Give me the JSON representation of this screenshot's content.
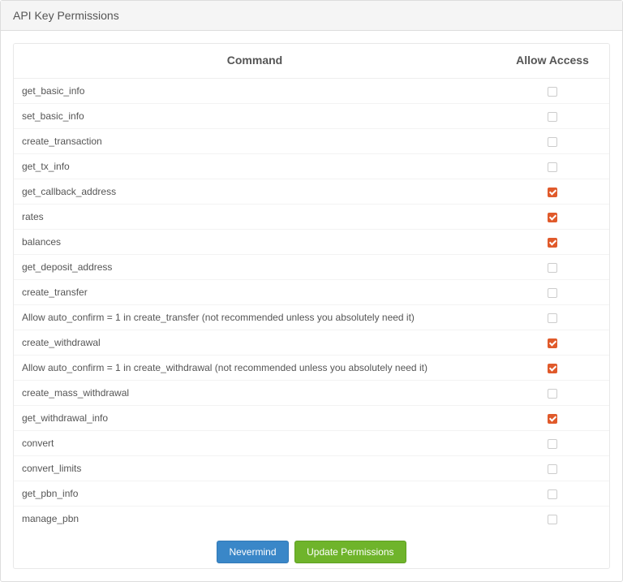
{
  "panel": {
    "title": "API Key Permissions"
  },
  "table": {
    "headers": {
      "command": "Command",
      "allow": "Allow Access"
    },
    "rows": [
      {
        "command": "get_basic_info",
        "checked": false
      },
      {
        "command": "set_basic_info",
        "checked": false
      },
      {
        "command": "create_transaction",
        "checked": false
      },
      {
        "command": "get_tx_info",
        "checked": false
      },
      {
        "command": "get_callback_address",
        "checked": true
      },
      {
        "command": "rates",
        "checked": true
      },
      {
        "command": "balances",
        "checked": true
      },
      {
        "command": "get_deposit_address",
        "checked": false
      },
      {
        "command": "create_transfer",
        "checked": false
      },
      {
        "command": "Allow auto_confirm = 1 in create_transfer (not recommended unless you absolutely need it)",
        "checked": false
      },
      {
        "command": "create_withdrawal",
        "checked": true
      },
      {
        "command": "Allow auto_confirm = 1 in create_withdrawal (not recommended unless you absolutely need it)",
        "checked": true
      },
      {
        "command": "create_mass_withdrawal",
        "checked": false
      },
      {
        "command": "get_withdrawal_info",
        "checked": true
      },
      {
        "command": "convert",
        "checked": false
      },
      {
        "command": "convert_limits",
        "checked": false
      },
      {
        "command": "get_pbn_info",
        "checked": false
      },
      {
        "command": "manage_pbn",
        "checked": false
      }
    ]
  },
  "buttons": {
    "nevermind": "Nevermind",
    "update": "Update Permissions"
  }
}
